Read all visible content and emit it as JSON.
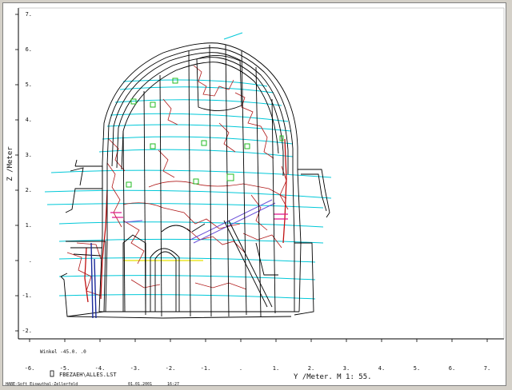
{
  "plot": {
    "x_ticks": [
      "-6.",
      "-5.",
      "-4.",
      "-3.",
      "-2.",
      "-1.",
      ".",
      "1.",
      "2.",
      "3.",
      "4.",
      "5.",
      "6.",
      "7."
    ],
    "y_ticks": [
      "7.",
      "6.",
      "5.",
      "4.",
      "3.",
      "2.",
      "1.",
      ".",
      "-1.",
      "-2."
    ],
    "y_axis_label": "Z /Meter",
    "x_axis_label": "Y /Meter.  M 1: 55.",
    "angle_label": "Winkel  -45.0.      .0",
    "file_label": "FBEZAEH\\ALLES.LST",
    "footer_credit": "HABE-Soft  Eiswuthal-Zellerfeld",
    "footer_date": "01.01.2001",
    "footer_time": "16:27"
  },
  "colors": {
    "background": "#ffffff",
    "window": "#d4d0c8",
    "outline": "#000000",
    "scan_lines": "#00c8d8",
    "stone_joints": "#b01818",
    "markers": "#22bb22",
    "diagonal": "#6a4fd8",
    "blue_post": "#1a2a9a",
    "yellow_line": "#e8e000"
  }
}
